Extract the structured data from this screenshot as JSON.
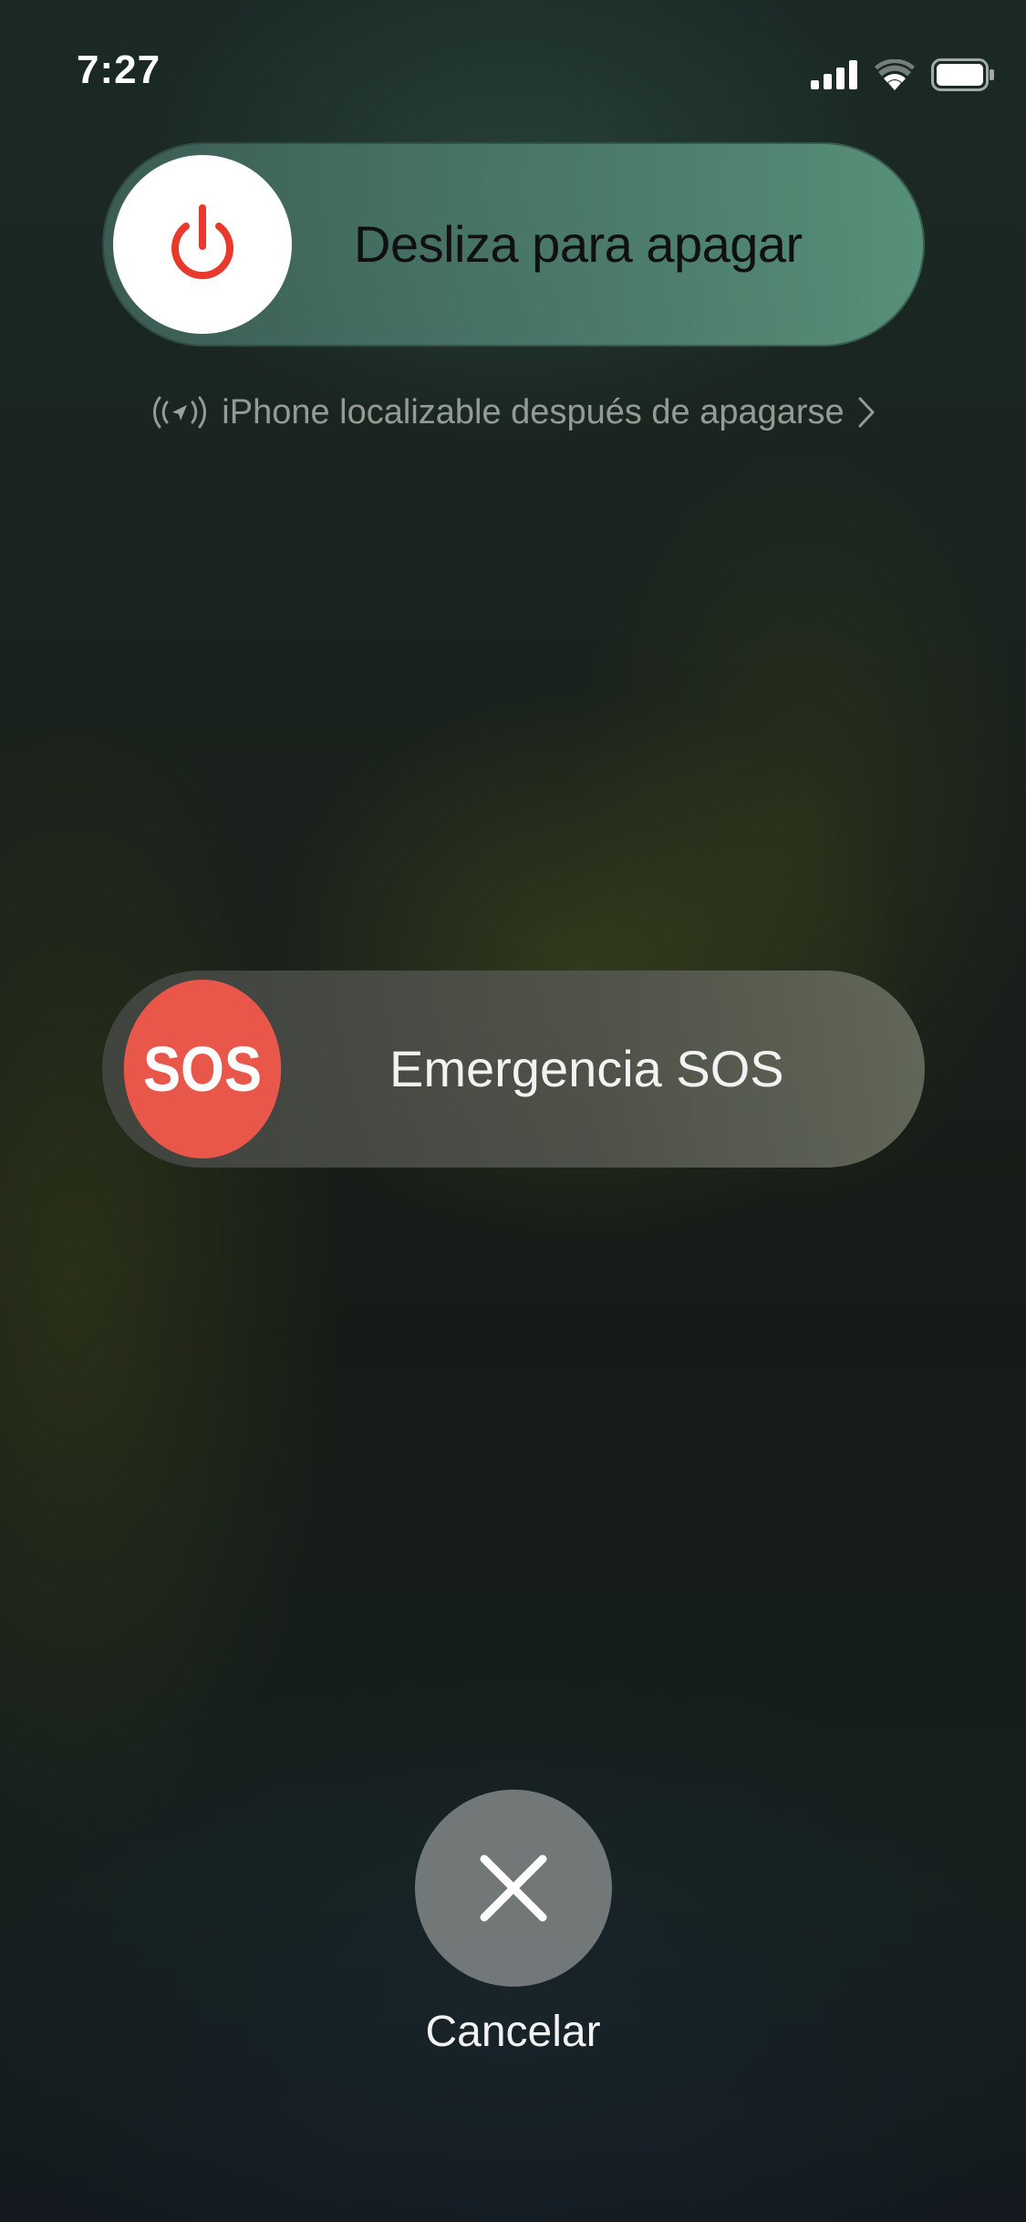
{
  "status_bar": {
    "time": "7:27",
    "icons": [
      "cellular-signal-icon",
      "wifi-icon",
      "battery-icon"
    ]
  },
  "power_slider": {
    "label": "Desliza para apagar",
    "knob_icon": "power-icon",
    "icon_color": "#e8392c"
  },
  "find_my": {
    "text": "iPhone localizable después de apagarse",
    "icon": "find-my-icon",
    "chevron": "chevron-right-icon"
  },
  "sos_slider": {
    "knob_text": "SOS",
    "label": "Emergencia SOS",
    "knob_color": "#e9564a"
  },
  "cancel": {
    "label": "Cancelar",
    "icon": "close-icon"
  }
}
